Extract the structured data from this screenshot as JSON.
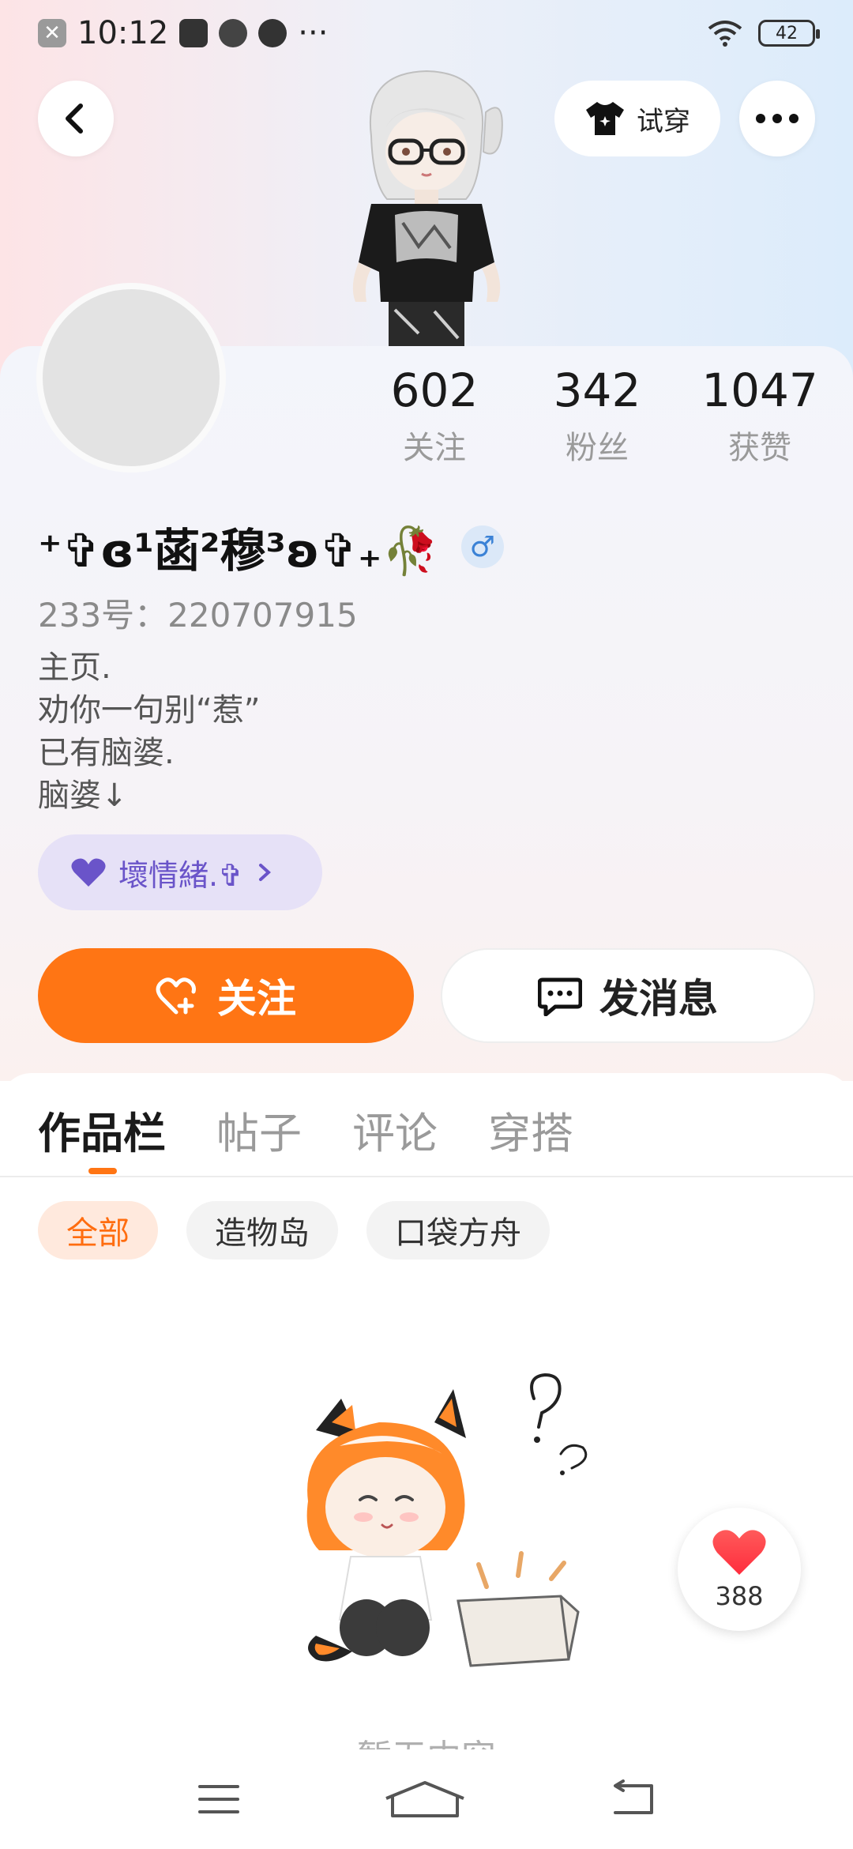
{
  "status_bar": {
    "time": "10:12",
    "extra": "···",
    "battery": "42"
  },
  "header": {
    "try_on_label": "试穿"
  },
  "profile": {
    "stats": [
      {
        "value": "602",
        "label": "关注"
      },
      {
        "value": "342",
        "label": "粉丝"
      },
      {
        "value": "1047",
        "label": "获赞"
      }
    ],
    "username": "⁺✞ɞ¹菡²穆³ʚ✞₊🥀",
    "gender_symbol": "♂",
    "uid": "233号：220707915",
    "bio_lines": [
      "主页.",
      "劝你一句别“惹”",
      "已有脑婆.",
      "脑婆↓"
    ],
    "mood_tag": "壞情緒.✞"
  },
  "actions": {
    "follow_label": "关注",
    "message_label": "发消息"
  },
  "tabs": [
    {
      "label": "作品栏",
      "active": true
    },
    {
      "label": "帖子",
      "active": false
    },
    {
      "label": "评论",
      "active": false
    },
    {
      "label": "穿搭",
      "active": false
    }
  ],
  "chips": [
    {
      "label": "全部",
      "active": true
    },
    {
      "label": "造物岛",
      "active": false
    },
    {
      "label": "口袋方舟",
      "active": false
    }
  ],
  "empty_state": {
    "text": "暂无内容"
  },
  "like_float": {
    "count": "388"
  },
  "colors": {
    "accent": "#ff7514",
    "mood": "#6a54c9",
    "gender": "#3b82d6"
  }
}
